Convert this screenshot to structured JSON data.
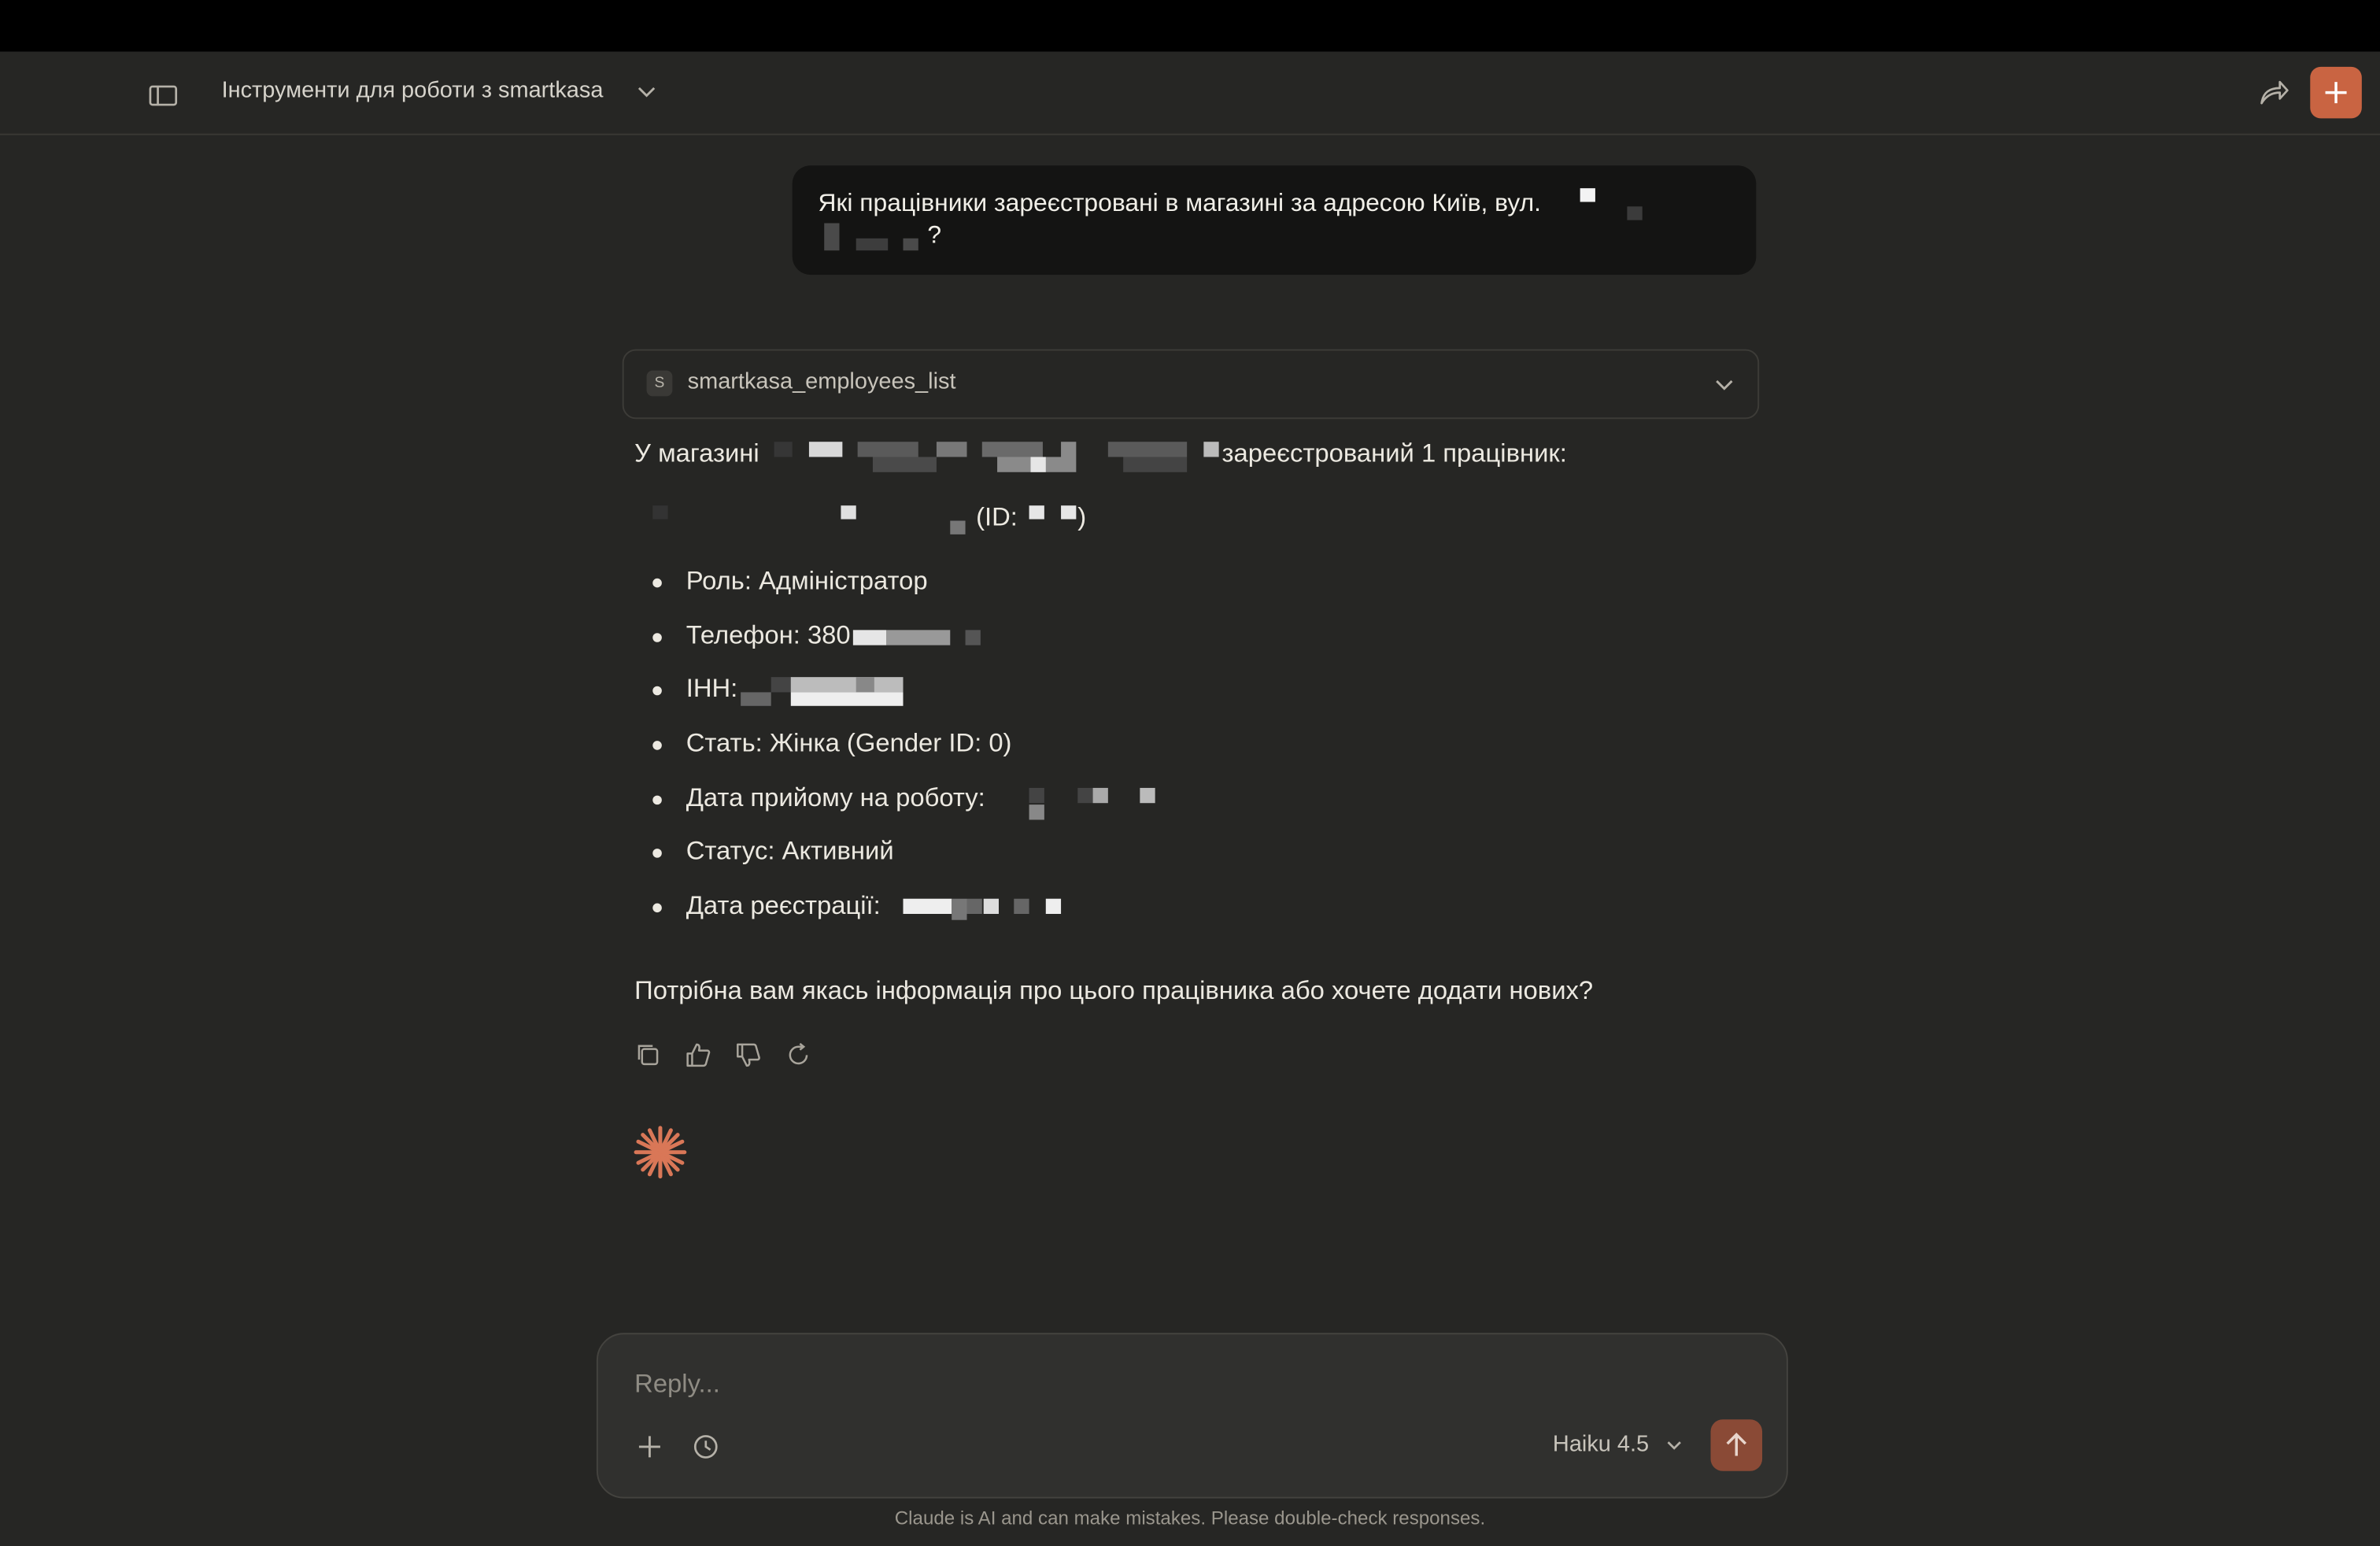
{
  "header": {
    "title": "Інструменти для роботи з smartkasa"
  },
  "user_message": {
    "text_line1": "Які працівники зареєстровані в магазині за адресою Київ, вул.",
    "text_line2_end": "?"
  },
  "tool_call": {
    "badge": "S",
    "name": "smartkasa_employees_list"
  },
  "response": {
    "intro_prefix": "У магазині",
    "intro_suffix": "зареєстрований 1 працівник:",
    "id_label": "(ID:",
    "id_close": ")",
    "items": [
      {
        "label": "Роль: Адміністратор"
      },
      {
        "label": "Телефон: 380"
      },
      {
        "label": "ІНН:"
      },
      {
        "label": "Стать: Жінка (Gender ID: 0)"
      },
      {
        "label": "Дата прийому на роботу:"
      },
      {
        "label": "Статус: Активний"
      },
      {
        "label": "Дата реєстрації:"
      }
    ],
    "closing": "Потрібна вам якась інформація про цього працівника або хочете додати нових?"
  },
  "composer": {
    "placeholder": "Reply...",
    "model": "Haiku 4.5"
  },
  "footer": {
    "disclaimer": "Claude is AI and can make mistakes. Please double-check responses."
  },
  "colors": {
    "accent": "#c96442",
    "background": "#262624"
  }
}
